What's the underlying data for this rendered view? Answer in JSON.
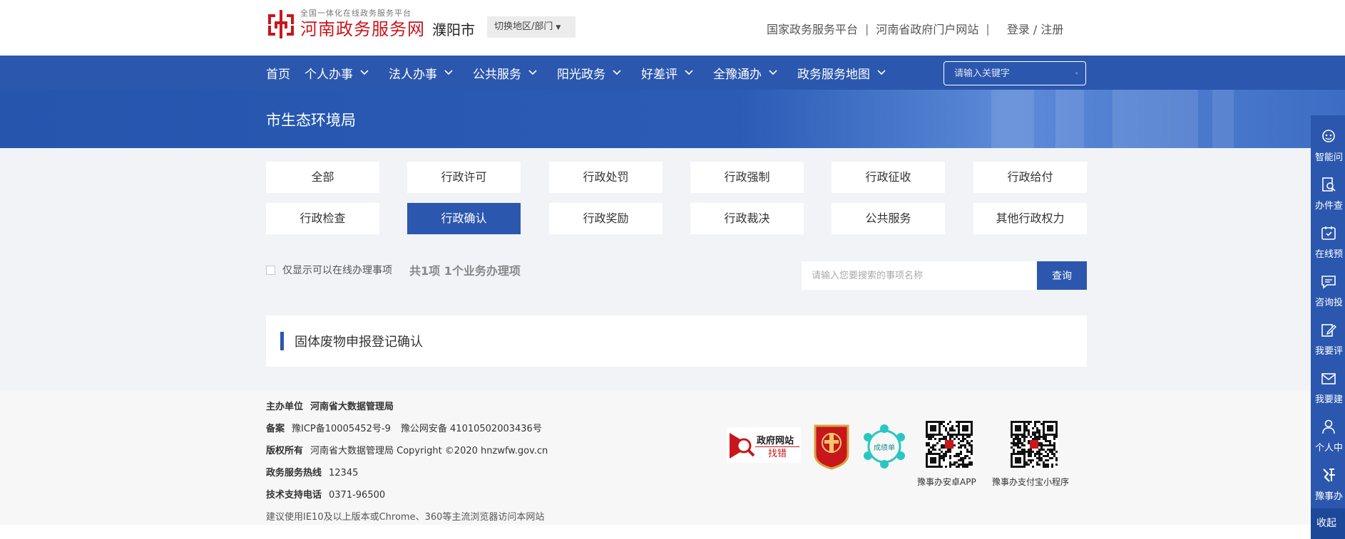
{
  "header": {
    "slogan": "全国一体化在线政务服务平台",
    "site_name": "河南政务服务网",
    "city": "濮阳市",
    "switch_label": "切换地区/部门",
    "links": [
      "国家政务服务平台",
      "河南省政府门户网站"
    ],
    "login": "登录 / 注册",
    "brand_color": "#c8161d"
  },
  "nav": {
    "items": [
      {
        "label": "首页",
        "dropdown": false
      },
      {
        "label": "个人办事",
        "dropdown": true
      },
      {
        "label": "法人办事",
        "dropdown": true
      },
      {
        "label": "公共服务",
        "dropdown": true
      },
      {
        "label": "阳光政务",
        "dropdown": true
      },
      {
        "label": "好差评",
        "dropdown": true
      },
      {
        "label": "全豫通办",
        "dropdown": true
      },
      {
        "label": "政务服务地图",
        "dropdown": true
      }
    ],
    "search_placeholder": "请输入关键字",
    "bg_color": "#2b57ae"
  },
  "banner": {
    "title": "市生态环境局"
  },
  "categories": {
    "items": [
      "全部",
      "行政许可",
      "行政处罚",
      "行政强制",
      "行政征收",
      "行政给付",
      "行政检查",
      "行政确认",
      "行政奖励",
      "行政裁决",
      "公共服务",
      "其他行政权力"
    ],
    "active": "行政确认"
  },
  "filter": {
    "online_only_label": "仅显示可以在线办理事项",
    "count_text": "共1项 1个业务办理项",
    "search_placeholder": "请输入您要搜索的事项名称",
    "search_button": "查询"
  },
  "results": [
    "固体废物申报登记确认"
  ],
  "footer": {
    "host_label": "主办单位",
    "host_value": "河南省大数据管理局",
    "record_label": "备案",
    "icp": "豫ICP备10005452号-9",
    "police_record": "豫公网安备 41010502003436号",
    "copyright_label": "版权所有",
    "copyright_value": "河南省大数据管理局 Copyright ©2020 hnzwfw.gov.cn",
    "hotline_label": "政务服务热线",
    "hotline_value": "12345",
    "support_label": "技术支持电话",
    "support_value": "0371-96500",
    "browser_tip": "建议使用IE10及以上版本或Chrome、360等主流浏览器访问本网站",
    "badge_gov_title": "政府网站",
    "badge_gov_sub": "找错",
    "badge_scorecard": "成绩单",
    "qr_app_label": "豫事办安卓APP",
    "qr_alipay_label": "豫事办支付宝小程序"
  },
  "float_bar": {
    "items": [
      {
        "label": "智能问",
        "icon": "robot-icon"
      },
      {
        "label": "办件查",
        "icon": "document-search-icon"
      },
      {
        "label": "在线预",
        "icon": "calendar-icon"
      },
      {
        "label": "咨询投",
        "icon": "chat-icon"
      },
      {
        "label": "我要评",
        "icon": "edit-icon"
      },
      {
        "label": "我要建",
        "icon": "mail-icon"
      },
      {
        "label": "个人中",
        "icon": "user-icon"
      },
      {
        "label": "豫事办",
        "icon": "app-logo-icon"
      }
    ],
    "collapse": "收起"
  }
}
